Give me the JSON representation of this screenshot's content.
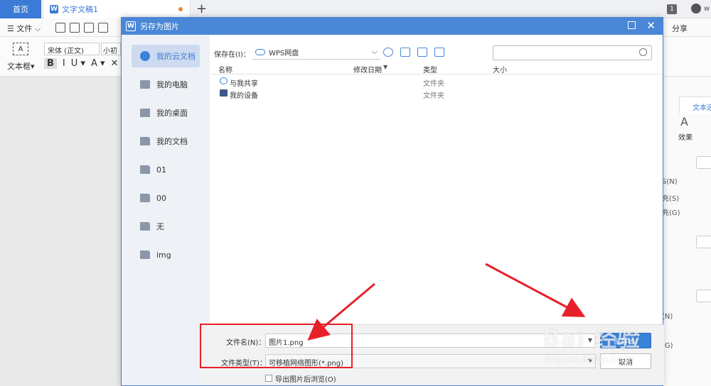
{
  "app": {
    "home_tab": "首页",
    "doc_tab": "文字文稿1",
    "doc_logo": "W",
    "new_tab": "+",
    "badge": "1",
    "user": "w"
  },
  "toolbar": {
    "file_menu": "☰ 文件 ⌵",
    "share": "分享"
  },
  "ribbon": {
    "textbox_icon": "A",
    "textbox_label": "文本框▾",
    "font_name": "宋体 (正文)",
    "font_size": "小初",
    "format_buttons": [
      "B",
      "I",
      "U ▾",
      "A ▾",
      "✕"
    ]
  },
  "panel": {
    "tab": "文本选",
    "effect_icon": "A",
    "effect_label": "效果",
    "opt1": "S(N)",
    "opt2": "充(S)",
    "opt3": "充(G)",
    "opt4": "(N)",
    "opt5": "(G)"
  },
  "dialog": {
    "logo": "W",
    "title": "另存为图片",
    "close": "✕",
    "sidebar": [
      {
        "label": "我的云文档",
        "icon": "cloud-icon",
        "active": true
      },
      {
        "label": "我的电脑",
        "icon": "computer-icon"
      },
      {
        "label": "我的桌面",
        "icon": "desktop-icon"
      },
      {
        "label": "我的文档",
        "icon": "folder-icon"
      },
      {
        "label": "01",
        "icon": "folder-icon"
      },
      {
        "label": "00",
        "icon": "folder-icon"
      },
      {
        "label": "无",
        "icon": "folder-icon"
      },
      {
        "label": "img",
        "icon": "folder-icon"
      }
    ],
    "save_in_label": "保存在(I)：",
    "save_in_value": "WPS网盘",
    "search_placeholder": "",
    "columns": {
      "name": "名称",
      "modified": "修改日期",
      "type": "类型",
      "size": "大小"
    },
    "rows": [
      {
        "name": "与我共享",
        "type": "文件夹"
      },
      {
        "name": "我的设备",
        "type": "文件夹"
      }
    ],
    "filename_label": "文件名(N)：",
    "filename_value": "图片1.png",
    "filetype_label": "文件类型(T)：",
    "filetype_value": "可移植网络图形(*.png)",
    "save_button": "保存(S)",
    "cancel_button": "取消",
    "open_after_export": "导出图片后浏览(O)"
  },
  "watermark": {
    "main": "Bai 经验",
    "sub": "jingyan.baidu.com"
  },
  "colors": {
    "accent": "#4a87d6",
    "annotation": "#e8202a"
  }
}
